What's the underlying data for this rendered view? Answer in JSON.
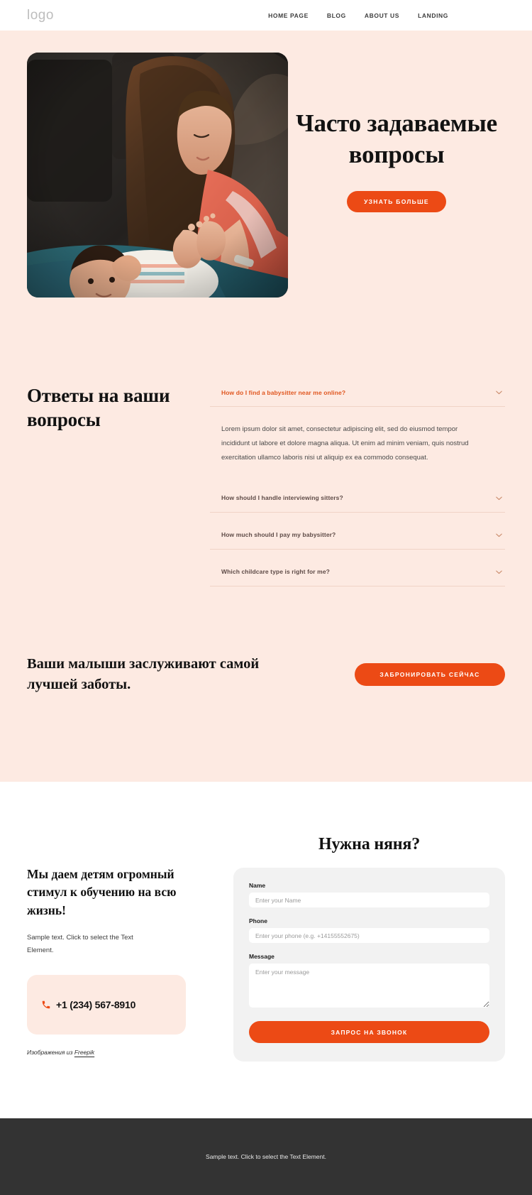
{
  "header": {
    "logo": "logo",
    "nav": [
      {
        "label": "HOME PAGE"
      },
      {
        "label": "BLOG"
      },
      {
        "label": "ABOUT US"
      },
      {
        "label": "LANDING"
      }
    ]
  },
  "hero": {
    "title": "Часто задаваемые вопросы",
    "cta_label": "УЗНАТЬ БОЛЬШЕ",
    "image_alt": "mother-and-baby-photo"
  },
  "faq": {
    "heading": "Ответы на ваши вопросы",
    "items": [
      {
        "question": "How do I find a babysitter near me online?",
        "open": true,
        "answer": "Lorem ipsum dolor sit amet, consectetur adipiscing elit, sed do eiusmod tempor incididunt ut labore et dolore magna aliqua. Ut enim ad minim veniam, quis nostrud exercitation ullamco laboris nisi ut aliquip ex ea commodo consequat."
      },
      {
        "question": "How should I handle interviewing sitters?",
        "open": false,
        "answer": ""
      },
      {
        "question": "How much should I pay my babysitter?",
        "open": false,
        "answer": ""
      },
      {
        "question": "Which childcare type is right for me?",
        "open": false,
        "answer": ""
      }
    ]
  },
  "book_cta": {
    "title": "Ваши малыши заслуживают самой лучшей заботы.",
    "button_label": "ЗАБРОНИРОВАТЬ СЕЙЧАС"
  },
  "contact": {
    "heading": "Мы даем детям огромный стимул к обучению на всю жизнь!",
    "subtext": "Sample text. Click to select the Text Element.",
    "phone": "+1 (234) 567-8910",
    "credit_prefix": "Изображения из ",
    "credit_link": "Freepik",
    "form": {
      "title": "Нужна няня?",
      "name_label": "Name",
      "name_placeholder": "Enter your Name",
      "name_value": "",
      "phone_label": "Phone",
      "phone_placeholder": "Enter your phone (e.g. +14155552675)",
      "phone_value": "",
      "message_label": "Message",
      "message_placeholder": "Enter your message",
      "message_value": "",
      "submit_label": "ЗАПРОС НА ЗВОНОК"
    }
  },
  "footer": {
    "text": "Sample text. Click to select the Text Element."
  },
  "colors": {
    "accent": "#ec4a15",
    "peach_bg": "#fdeae2",
    "footer_bg": "#333333",
    "form_bg": "#f2f2f2"
  }
}
